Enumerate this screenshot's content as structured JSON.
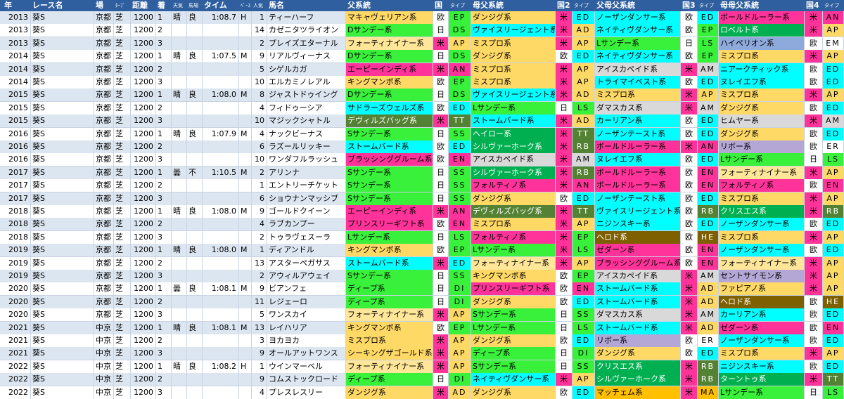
{
  "header": {
    "year": "年",
    "race": "レース名",
    "course": "場",
    "surface": "ﾀｰﾌﾞ",
    "distance": "距離",
    "finish": "着",
    "weather": "天気",
    "going": "馬場",
    "time": "タイム",
    "pace": "ﾍﾟｰｽ",
    "popularity": "人気",
    "horse": "馬名",
    "sire_line": "父系統",
    "country": "国",
    "type": "タイプ",
    "dam_sire_line": "母父系統",
    "country2": "国2",
    "type2": "タイプ",
    "sire_of_dam_sire": "父母父系統",
    "country3": "国3",
    "type3": "タイプ",
    "dam_dam_sire": "母母父系統",
    "country4": "国4",
    "type4": "タイプ"
  },
  "colors": {
    "header_bg": "#2f5f9e",
    "row_alt": "#dce6f1",
    "sire_lines": {
      "マキャヴェリアン系": "#ffd966",
      "Dサンデー系": "#39f03a",
      "フォーティナイナー系": "#ffe699",
      "エーピーインディ系": "#ff3399",
      "キングマンボ系": "#ffd966",
      "サドラーズウェルズ系": "#00ffff",
      "デヴィルズバッグ系": "#548235",
      "Sサンデー系": "#39f03a",
      "ストームバード系": "#00ffff",
      "ブラッシンググルーム系": "#ff3399",
      "プリンスリーギフト系": "#ff3399",
      "Lサンデー系": "#39f03a",
      "ディープ系": "#39f03a",
      "ミスプロ系": "#ffd966",
      "シーキングザゴールド系": "#ffd966",
      "ダンジグ系": "#ffd966",
      "ヴァイスリージェント系": "#00ffff",
      "ヘイロー系": "#00b050",
      "シルヴァーホーク系": "#00b050",
      "アイスカペイド系": "#d9d9d9",
      "フォルティノ系": "#ff3399",
      "ネイティヴダンサー系": "#00ffff",
      "ノーザンダンサー系": "#00ffff",
      "ダマスカス系": "#d9d9d9",
      "カーリアン系": "#00ffff",
      "ボールドルーラー系": "#ff3399",
      "ヒムヤー系": "#d9d9d9",
      "ロベルト系": "#00b050",
      "ハイペリオン系": "#8ea9db",
      "ニアークティック系": "#00ffff",
      "ヌレイエフ系": "#00ffff",
      "トライマイベスト系": "#00ffff",
      "ノーザンテースト系": "#00ffff",
      "リボー系": "#b4a7d6",
      "クリスエス系": "#00b050",
      "ニジンスキー系": "#00ffff",
      "ヘロド系": "#7f6000",
      "ゼダーン系": "#ff3399",
      "セントサイモン系": "#b4a7d6",
      "ファピアノ系": "#ffd966",
      "マッチェム系": "#ffc000",
      "ターントゥ系": "#00b050"
    },
    "countries": {
      "欧": "#ffffff",
      "日": "#ffffff",
      "米": "#ff3399"
    },
    "type_colors": {
      "EP": "#39f03a",
      "DS": "#39f03a",
      "AP": "#ffd966",
      "AN": "#ff3399",
      "LS": "#39f03a",
      "AD": "#ffd966",
      "TT": "#548235",
      "SS": "#39f03a",
      "ED": "#00ffff",
      "EN": "#ff3399",
      "DI": "#39f03a",
      "RB": "#548235",
      "AM": "#d9d9d9",
      "HE": "#7f6000",
      "MA": "#ffc000"
    }
  },
  "rows": [
    {
      "year": "2013",
      "race": "葵S",
      "course": "京都",
      "surface": "芝",
      "distance": "1200",
      "finish": "1",
      "weather": "晴",
      "going": "良",
      "time": "1:08.7",
      "pace": "H",
      "popularity": "1",
      "horse": "ティーハーフ",
      "sire": "マキャヴェリアン系",
      "c1": "欧",
      "t1": "EP",
      "dam_sire": "ダンジグ系",
      "c2": "米",
      "t2": "ED",
      "sod": "ノーザンダンサー系",
      "c3": "欧",
      "t3": "ED",
      "dds": "ボールドルーラー系",
      "c4": "米",
      "t4": "AN"
    },
    {
      "year": "2013",
      "race": "葵S",
      "course": "京都",
      "surface": "芝",
      "distance": "1200",
      "finish": "2",
      "weather": "",
      "going": "",
      "time": "",
      "pace": "",
      "popularity": "14",
      "horse": "カゼニタツライオン",
      "sire": "Dサンデー系",
      "c1": "日",
      "t1": "DS",
      "dam_sire": "ヴァイスリージェント系",
      "c2": "米",
      "t2": "AD",
      "sod": "ネイティヴダンサー系",
      "c3": "欧",
      "t3": "EP",
      "dds": "ロベルト系",
      "c4": "米",
      "t4": "AP"
    },
    {
      "year": "2013",
      "race": "葵S",
      "course": "京都",
      "surface": "芝",
      "distance": "1200",
      "finish": "3",
      "weather": "",
      "going": "",
      "time": "",
      "pace": "",
      "popularity": "2",
      "horse": "プレイズエターナル",
      "sire": "フォーティナイナー系",
      "c1": "米",
      "t1": "AP",
      "dam_sire": "ミスプロ系",
      "c2": "米",
      "t2": "AP",
      "sod": "Lサンデー系",
      "c3": "日",
      "t3": "LS",
      "dds": "ハイペリオン系",
      "c4": "欧",
      "t4": "EM"
    },
    {
      "year": "2014",
      "race": "葵S",
      "course": "京都",
      "surface": "芝",
      "distance": "1200",
      "finish": "1",
      "weather": "晴",
      "going": "良",
      "time": "1:07.5",
      "pace": "M",
      "popularity": "9",
      "horse": "リアルヴィーナス",
      "sire": "Dサンデー系",
      "c1": "日",
      "t1": "DS",
      "dam_sire": "ダンジグ系",
      "c2": "欧",
      "t2": "ED",
      "sod": "ネイティヴダンサー系",
      "c3": "欧",
      "t3": "EP",
      "dds": "ミスプロ系",
      "c4": "米",
      "t4": "AP"
    },
    {
      "year": "2014",
      "race": "葵S",
      "course": "京都",
      "surface": "芝",
      "distance": "1200",
      "finish": "2",
      "weather": "",
      "going": "",
      "time": "",
      "pace": "",
      "popularity": "5",
      "horse": "シゲルカガ",
      "sire": "エーピーインディ系",
      "c1": "米",
      "t1": "AN",
      "dam_sire": "ミスプロ系",
      "c2": "米",
      "t2": "AP",
      "sod": "アイスカペイド系",
      "c3": "米",
      "t3": "AM",
      "dds": "ニアークティック系",
      "c4": "欧",
      "t4": "ED"
    },
    {
      "year": "2014",
      "race": "葵S",
      "course": "京都",
      "surface": "芝",
      "distance": "1200",
      "finish": "3",
      "weather": "",
      "going": "",
      "time": "",
      "pace": "",
      "popularity": "10",
      "horse": "エルカミノレアル",
      "sire": "キングマンボ系",
      "c1": "欧",
      "t1": "EP",
      "dam_sire": "ミスプロ系",
      "c2": "米",
      "t2": "AP",
      "sod": "トライマイベスト系",
      "c3": "欧",
      "t3": "ED",
      "dds": "ヌレイエフ系",
      "c4": "欧",
      "t4": "ED"
    },
    {
      "year": "2015",
      "race": "葵S",
      "course": "京都",
      "surface": "芝",
      "distance": "1200",
      "finish": "1",
      "weather": "晴",
      "going": "良",
      "time": "1:08.0",
      "pace": "M",
      "popularity": "8",
      "horse": "ジャストドゥイング",
      "sire": "Dサンデー系",
      "c1": "日",
      "t1": "DS",
      "dam_sire": "ヴァイスリージェント系",
      "c2": "米",
      "t2": "AD",
      "sod": "ミスプロ系",
      "c3": "米",
      "t3": "AP",
      "dds": "ミスプロ系",
      "c4": "米",
      "t4": "AP"
    },
    {
      "year": "2015",
      "race": "葵S",
      "course": "京都",
      "surface": "芝",
      "distance": "1200",
      "finish": "2",
      "weather": "",
      "going": "",
      "time": "",
      "pace": "",
      "popularity": "4",
      "horse": "フィドゥーシア",
      "sire": "サドラーズウェルズ系",
      "c1": "欧",
      "t1": "ED",
      "dam_sire": "Lサンデー系",
      "c2": "日",
      "t2": "LS",
      "sod": "ダマスカス系",
      "c3": "米",
      "t3": "AM",
      "dds": "ダンジグ系",
      "c4": "欧",
      "t4": "ED"
    },
    {
      "year": "2015",
      "race": "葵S",
      "course": "京都",
      "surface": "芝",
      "distance": "1200",
      "finish": "3",
      "weather": "",
      "going": "",
      "time": "",
      "pace": "",
      "popularity": "10",
      "horse": "マジックシャトル",
      "sire": "デヴィルズバッグ系",
      "c1": "米",
      "t1": "TT",
      "dam_sire": "ストームバード系",
      "c2": "米",
      "t2": "AD",
      "sod": "カーリアン系",
      "c3": "欧",
      "t3": "ED",
      "dds": "ヒムヤー系",
      "c4": "米",
      "t4": "AM"
    },
    {
      "year": "2016",
      "race": "葵S",
      "course": "京都",
      "surface": "芝",
      "distance": "1200",
      "finish": "1",
      "weather": "晴",
      "going": "良",
      "time": "1:07.9",
      "pace": "M",
      "popularity": "4",
      "horse": "ナックビーナス",
      "sire": "Sサンデー系",
      "c1": "日",
      "t1": "SS",
      "dam_sire": "ヘイロー系",
      "c2": "米",
      "t2": "TT",
      "sod": "ノーザンテースト系",
      "c3": "欧",
      "t3": "ED",
      "dds": "ダンジグ系",
      "c4": "欧",
      "t4": "ED"
    },
    {
      "year": "2016",
      "race": "葵S",
      "course": "京都",
      "surface": "芝",
      "distance": "1200",
      "finish": "2",
      "weather": "",
      "going": "",
      "time": "",
      "pace": "",
      "popularity": "6",
      "horse": "ラズールリッキー",
      "sire": "ストームバード系",
      "c1": "欧",
      "t1": "ED",
      "dam_sire": "シルヴァーホーク系",
      "c2": "米",
      "t2": "RB",
      "sod": "ボールドルーラー系",
      "c3": "米",
      "t3": "AN",
      "dds": "リボー系",
      "c4": "欧",
      "t4": "ER"
    },
    {
      "year": "2016",
      "race": "葵S",
      "course": "京都",
      "surface": "芝",
      "distance": "1200",
      "finish": "3",
      "weather": "",
      "going": "",
      "time": "",
      "pace": "",
      "popularity": "10",
      "horse": "ワンダフルラッシュ",
      "sire": "ブラッシンググルーム系",
      "c1": "欧",
      "t1": "EN",
      "dam_sire": "アイスカペイド系",
      "c2": "米",
      "t2": "AM",
      "sod": "ヌレイエフ系",
      "c3": "欧",
      "t3": "ED",
      "dds": "Lサンデー系",
      "c4": "日",
      "t4": "LS"
    },
    {
      "year": "2017",
      "race": "葵S",
      "course": "京都",
      "surface": "芝",
      "distance": "1200",
      "finish": "1",
      "weather": "曇",
      "going": "不",
      "time": "1:10.5",
      "pace": "M",
      "popularity": "2",
      "horse": "アリンナ",
      "sire": "Sサンデー系",
      "c1": "日",
      "t1": "SS",
      "dam_sire": "シルヴァーホーク系",
      "c2": "米",
      "t2": "RB",
      "sod": "ボールドルーラー系",
      "c3": "欧",
      "t3": "EN",
      "dds": "フォーティナイナー系",
      "c4": "米",
      "t4": "AP"
    },
    {
      "year": "2017",
      "race": "葵S",
      "course": "京都",
      "surface": "芝",
      "distance": "1200",
      "finish": "2",
      "weather": "",
      "going": "",
      "time": "",
      "pace": "",
      "popularity": "1",
      "horse": "エントリーチケット",
      "sire": "Sサンデー系",
      "c1": "日",
      "t1": "SS",
      "dam_sire": "フォルティノ系",
      "c2": "米",
      "t2": "AN",
      "sod": "ボールドルーラー系",
      "c3": "欧",
      "t3": "EN",
      "dds": "フォルティノ系",
      "c4": "欧",
      "t4": "EN"
    },
    {
      "year": "2017",
      "race": "葵S",
      "course": "京都",
      "surface": "芝",
      "distance": "1200",
      "finish": "3",
      "weather": "",
      "going": "",
      "time": "",
      "pace": "",
      "popularity": "6",
      "horse": "ショウナンマッシブ",
      "sire": "Sサンデー系",
      "c1": "日",
      "t1": "SS",
      "dam_sire": "ダンジグ系",
      "c2": "欧",
      "t2": "ED",
      "sod": "ノーザンテースト系",
      "c3": "欧",
      "t3": "ED",
      "dds": "ミスプロ系",
      "c4": "米",
      "t4": "AP"
    },
    {
      "year": "2018",
      "race": "葵S",
      "course": "京都",
      "surface": "芝",
      "distance": "1200",
      "finish": "1",
      "weather": "晴",
      "going": "良",
      "time": "1:08.0",
      "pace": "M",
      "popularity": "9",
      "horse": "ゴールドクイーン",
      "sire": "エーピーインディ系",
      "c1": "米",
      "t1": "AN",
      "dam_sire": "デヴィルズバッグ系",
      "c2": "米",
      "t2": "TT",
      "sod": "ヴァイスリージェント系",
      "c3": "欧",
      "t3": "RB",
      "dds": "クリスエス系",
      "c4": "米",
      "t4": "RB"
    },
    {
      "year": "2018",
      "race": "葵S",
      "course": "京都",
      "surface": "芝",
      "distance": "1200",
      "finish": "2",
      "weather": "",
      "going": "",
      "time": "",
      "pace": "",
      "popularity": "4",
      "horse": "ラブカンプー",
      "sire": "プリンスリーギフト系",
      "c1": "欧",
      "t1": "EN",
      "dam_sire": "ミスプロ系",
      "c2": "米",
      "t2": "AP",
      "sod": "ニジンスキー系",
      "c3": "欧",
      "t3": "ED",
      "dds": "ノーザンダンサー系",
      "c4": "欧",
      "t4": "ED"
    },
    {
      "year": "2018",
      "race": "葵S",
      "course": "京都",
      "surface": "芝",
      "distance": "1200",
      "finish": "3",
      "weather": "",
      "going": "",
      "time": "",
      "pace": "",
      "popularity": "2",
      "horse": "トゥラヴェスーラ",
      "sire": "Lサンデー系",
      "c1": "日",
      "t1": "LS",
      "dam_sire": "フォルティノ系",
      "c2": "米",
      "t2": "EP",
      "sod": "ヘロド系",
      "c3": "欧",
      "t3": "HE",
      "dds": "ミスプロ系",
      "c4": "米",
      "t4": "AP"
    },
    {
      "year": "2019",
      "race": "葵S",
      "course": "京都",
      "surface": "芝",
      "distance": "1200",
      "finish": "1",
      "weather": "晴",
      "going": "良",
      "time": "1:08.0",
      "pace": "M",
      "popularity": "1",
      "horse": "ディアンドル",
      "sire": "キングマンボ系",
      "c1": "欧",
      "t1": "EP",
      "dam_sire": "Lサンデー系",
      "c2": "米",
      "t2": "LS",
      "sod": "ゼダーン系",
      "c3": "欧",
      "t3": "EN",
      "dds": "ノーザンダンサー系",
      "c4": "欧",
      "t4": "ED"
    },
    {
      "year": "2019",
      "race": "葵S",
      "course": "京都",
      "surface": "芝",
      "distance": "1200",
      "finish": "2",
      "weather": "",
      "going": "",
      "time": "",
      "pace": "",
      "popularity": "13",
      "horse": "アスターペガサス",
      "sire": "ストームバード系",
      "c1": "米",
      "t1": "ED",
      "dam_sire": "フォーティナイナー系",
      "c2": "米",
      "t2": "AP",
      "sod": "ブラッシンググルーム系",
      "c3": "欧",
      "t3": "EN",
      "dds": "フォーティナイナー系",
      "c4": "米",
      "t4": "AP"
    },
    {
      "year": "2019",
      "race": "葵S",
      "course": "京都",
      "surface": "芝",
      "distance": "1200",
      "finish": "3",
      "weather": "",
      "going": "",
      "time": "",
      "pace": "",
      "popularity": "2",
      "horse": "アウィルアウェイ",
      "sire": "Sサンデー系",
      "c1": "日",
      "t1": "SS",
      "dam_sire": "キングマンボ系",
      "c2": "欧",
      "t2": "EP",
      "sod": "アイスカペイド系",
      "c3": "米",
      "t3": "AM",
      "dds": "セントサイモン系",
      "c4": "米",
      "t4": "AP"
    },
    {
      "year": "2020",
      "race": "葵S",
      "course": "京都",
      "surface": "芝",
      "distance": "1200",
      "finish": "1",
      "weather": "曇",
      "going": "良",
      "time": "1:08.1",
      "pace": "M",
      "popularity": "9",
      "horse": "ビアンフェ",
      "sire": "ディープ系",
      "c1": "日",
      "t1": "DI",
      "dam_sire": "プリンスリーギフト系",
      "c2": "欧",
      "t2": "EN",
      "sod": "ストームバード系",
      "c3": "米",
      "t3": "AD",
      "dds": "ファピアノ系",
      "c4": "米",
      "t4": "AP"
    },
    {
      "year": "2020",
      "race": "葵S",
      "course": "京都",
      "surface": "芝",
      "distance": "1200",
      "finish": "2",
      "weather": "",
      "going": "",
      "time": "",
      "pace": "",
      "popularity": "11",
      "horse": "レジェーロ",
      "sire": "ディープ系",
      "c1": "日",
      "t1": "DI",
      "dam_sire": "ダンジグ系",
      "c2": "欧",
      "t2": "ED",
      "sod": "ストームバード系",
      "c3": "米",
      "t3": "AD",
      "dds": "ヘロド系",
      "c4": "欧",
      "t4": "HE"
    },
    {
      "year": "2020",
      "race": "葵S",
      "course": "京都",
      "surface": "芝",
      "distance": "1200",
      "finish": "3",
      "weather": "",
      "going": "",
      "time": "",
      "pace": "",
      "popularity": "5",
      "horse": "ワンスカイ",
      "sire": "フォーティナイナー系",
      "c1": "米",
      "t1": "AP",
      "dam_sire": "Sサンデー系",
      "c2": "日",
      "t2": "SS",
      "sod": "ダマスカス系",
      "c3": "米",
      "t3": "AM",
      "dds": "カーリアン系",
      "c4": "欧",
      "t4": "ED"
    },
    {
      "year": "2021",
      "race": "葵S",
      "course": "中京",
      "surface": "芝",
      "distance": "1200",
      "finish": "1",
      "weather": "晴",
      "going": "良",
      "time": "1:08.1",
      "pace": "M",
      "popularity": "13",
      "horse": "レイハリア",
      "sire": "キングマンボ系",
      "c1": "欧",
      "t1": "EP",
      "dam_sire": "Lサンデー系",
      "c2": "日",
      "t2": "LS",
      "sod": "ストームバード系",
      "c3": "米",
      "t3": "AD",
      "dds": "ゼダーン系",
      "c4": "欧",
      "t4": "EN"
    },
    {
      "year": "2021",
      "race": "葵S",
      "course": "中京",
      "surface": "芝",
      "distance": "1200",
      "finish": "2",
      "weather": "",
      "going": "",
      "time": "",
      "pace": "",
      "popularity": "3",
      "horse": "ヨカヨカ",
      "sire": "ミスプロ系",
      "c1": "米",
      "t1": "AP",
      "dam_sire": "ダンジグ系",
      "c2": "欧",
      "t2": "ED",
      "sod": "リボー系",
      "c3": "欧",
      "t3": "ER",
      "dds": "ノーザンダンサー系",
      "c4": "欧",
      "t4": "ED"
    },
    {
      "year": "2021",
      "race": "葵S",
      "course": "中京",
      "surface": "芝",
      "distance": "1200",
      "finish": "3",
      "weather": "",
      "going": "",
      "time": "",
      "pace": "",
      "popularity": "9",
      "horse": "オールアットワンス",
      "sire": "シーキングザゴールド系",
      "c1": "米",
      "t1": "AP",
      "dam_sire": "ディープ系",
      "c2": "日",
      "t2": "DI",
      "sod": "ダンジグ系",
      "c3": "欧",
      "t3": "ED",
      "dds": "ミスプロ系",
      "c4": "米",
      "t4": "AP"
    },
    {
      "year": "2022",
      "race": "葵S",
      "course": "中京",
      "surface": "芝",
      "distance": "1200",
      "finish": "1",
      "weather": "晴",
      "going": "良",
      "time": "1:08.2",
      "pace": "H",
      "popularity": "1",
      "horse": "ウインマーベル",
      "sire": "フォーティナイナー系",
      "c1": "米",
      "t1": "AP",
      "dam_sire": "Sサンデー系",
      "c2": "日",
      "t2": "SS",
      "sod": "クリスエス系",
      "c3": "米",
      "t3": "RB",
      "dds": "ニジンスキー系",
      "c4": "欧",
      "t4": "ED"
    },
    {
      "year": "2022",
      "race": "葵S",
      "course": "中京",
      "surface": "芝",
      "distance": "1200",
      "finish": "2",
      "weather": "",
      "going": "",
      "time": "",
      "pace": "",
      "popularity": "9",
      "horse": "コムストックロード",
      "sire": "ディープ系",
      "c1": "日",
      "t1": "DI",
      "dam_sire": "ネイティヴダンサー系",
      "c2": "米",
      "t2": "AP",
      "sod": "シルヴァーホーク系",
      "c3": "米",
      "t3": "RB",
      "dds": "ターントゥ系",
      "c4": "米",
      "t4": "TT"
    },
    {
      "year": "2022",
      "race": "葵S",
      "course": "中京",
      "surface": "芝",
      "distance": "1200",
      "finish": "3",
      "weather": "",
      "going": "",
      "time": "",
      "pace": "",
      "popularity": "4",
      "horse": "プレスレスリー",
      "sire": "ダンジグ系",
      "c1": "米",
      "t1": "AD",
      "dam_sire": "ダンジグ系",
      "c2": "欧",
      "t2": "ED",
      "sod": "マッチェム系",
      "c3": "米",
      "t3": "MA",
      "dds": "Lサンデー系",
      "c4": "日",
      "t4": "LS"
    }
  ]
}
